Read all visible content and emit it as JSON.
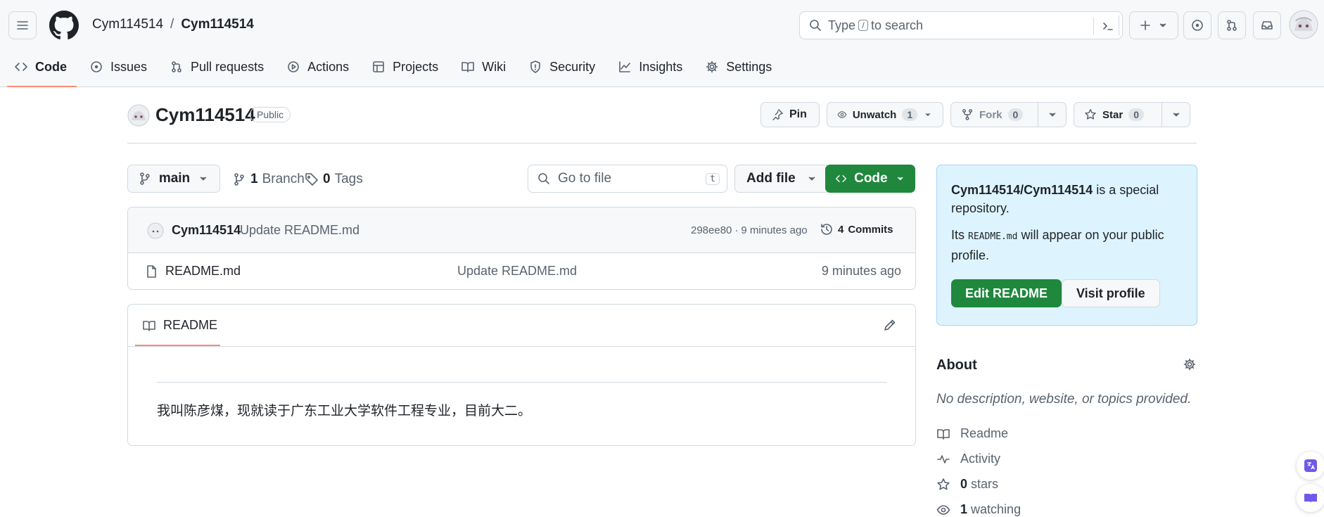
{
  "header": {
    "owner": "Cym114514",
    "separator": "/",
    "repo": "Cym114514",
    "search_prefix": "Type",
    "search_key": "/",
    "search_suffix": "to search",
    "new_label": "+"
  },
  "tabs": [
    {
      "label": "Code",
      "icon": "code-icon",
      "active": true
    },
    {
      "label": "Issues",
      "icon": "issue-icon"
    },
    {
      "label": "Pull requests",
      "icon": "pull-request-icon"
    },
    {
      "label": "Actions",
      "icon": "play-icon"
    },
    {
      "label": "Projects",
      "icon": "table-icon"
    },
    {
      "label": "Wiki",
      "icon": "book-icon"
    },
    {
      "label": "Security",
      "icon": "shield-icon"
    },
    {
      "label": "Insights",
      "icon": "graph-icon"
    },
    {
      "label": "Settings",
      "icon": "gear-icon"
    }
  ],
  "repo": {
    "name": "Cym114514",
    "visibility": "Public",
    "pin_label": "Pin",
    "watch_label": "Unwatch",
    "watch_count": "1",
    "fork_label": "Fork",
    "fork_count": "0",
    "star_label": "Star",
    "star_count": "0"
  },
  "branch": {
    "current": "main",
    "branch_count": "1",
    "branch_label": "Branch",
    "tag_count": "0",
    "tag_label": "Tags",
    "go_to_file": "Go to file",
    "go_to_file_key": "t",
    "add_file": "Add file",
    "code_button": "Code"
  },
  "latest_commit": {
    "author": "Cym114514",
    "message": "Update README.md",
    "sha": "298ee80",
    "dot": "·",
    "time": "9 minutes ago",
    "commits_count": "4",
    "commits_label": "Commits"
  },
  "files": [
    {
      "name": "README.md",
      "message": "Update README.md",
      "time": "9 minutes ago"
    }
  ],
  "readme": {
    "tab_label": "README",
    "content": "我叫陈彦煤，现就读于广东工业大学软件工程专业，目前大二。"
  },
  "special_box": {
    "repo_path": "Cym114514/Cym114514",
    "text1": " is a special repository.",
    "text2a": "Its ",
    "code": "README.md",
    "text2b": " will appear on your public profile.",
    "edit_button": "Edit README",
    "visit_button": "Visit profile"
  },
  "about": {
    "title": "About",
    "description": "No description, website, or topics provided.",
    "readme_link": "Readme",
    "activity_link": "Activity",
    "stars_count": "0",
    "stars_label": "stars",
    "watching_count": "1",
    "watching_label": "watching"
  },
  "colors": {
    "accent_green": "#1f883d",
    "tab_underline": "#fd8c73",
    "header_bg": "#f6f8fa",
    "special_bg": "#ddf4ff"
  }
}
